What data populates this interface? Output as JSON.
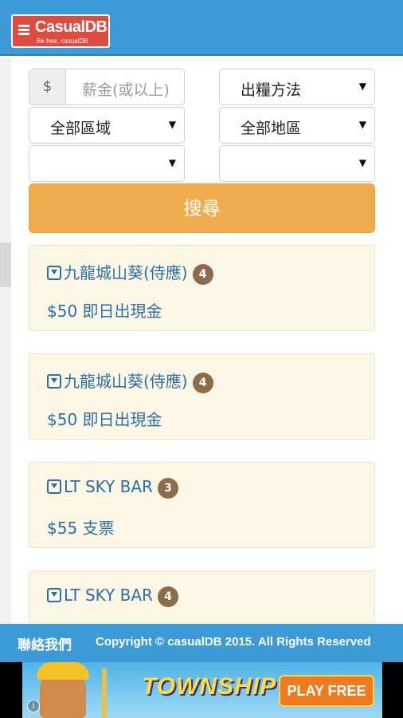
{
  "header": {
    "logo_name": "CasualDB",
    "logo_tagline": "Be free, casualDB"
  },
  "filters": {
    "currency_symbol": "$",
    "salary_placeholder": "薪金(或以上)",
    "pay_method": "出糧方法",
    "region_all": "全部區域",
    "district_all": "全部地區",
    "blank_left": "",
    "blank_right": "",
    "search_button": "搜尋"
  },
  "listings": [
    {
      "title": "九龍城山葵(侍應)",
      "count": "4",
      "price": "$50 即日出現金"
    },
    {
      "title": "九龍城山葵(侍應)",
      "count": "4",
      "price": "$50 即日出現金"
    },
    {
      "title": "LT SKY BAR",
      "count": "3",
      "price": "$55 支票"
    },
    {
      "title": "LT SKY BAR",
      "count": "4",
      "price": ""
    }
  ],
  "footer": {
    "contact": "聯絡我們",
    "copyright": "Copyright © casualDB 2015. All Rights Reserved"
  },
  "ad": {
    "brand": "TOWNSHIP",
    "cta": "PLAY FREE",
    "info": "i"
  },
  "colors": {
    "primary": "#3c9bd6",
    "accent": "#f0ad4e",
    "card_bg": "#fcf7e4",
    "link": "#2a6fa8",
    "badge": "#8b6d4a"
  }
}
